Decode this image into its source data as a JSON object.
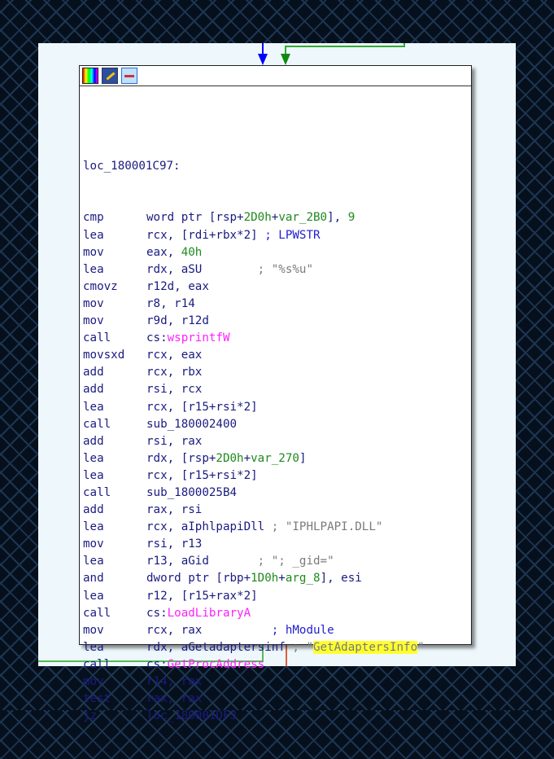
{
  "colors": {
    "edge_in": "#0000ff",
    "edge_true": "#22aa22",
    "edge_false": "#e05030",
    "highlight": "#ffff30"
  },
  "header_icons": [
    "color-palette-icon",
    "edit-node-icon",
    "group-nodes-icon"
  ],
  "label": "loc_180001C97:",
  "lines": [
    {
      "mn": "cmp",
      "ops": [
        [
          "word ptr [rsp+",
          "n"
        ],
        [
          "2D0h",
          "g"
        ],
        [
          "+",
          "n"
        ],
        [
          "var_2B0",
          "g"
        ],
        [
          "], ",
          "n"
        ],
        [
          "9",
          "g"
        ]
      ]
    },
    {
      "mn": "lea",
      "ops": [
        [
          "rcx, [rdi+rbx*2] ",
          "n"
        ],
        [
          "; LPWSTR",
          "b"
        ]
      ]
    },
    {
      "mn": "mov",
      "ops": [
        [
          "eax, ",
          "n"
        ],
        [
          "40h",
          "g"
        ]
      ]
    },
    {
      "mn": "lea",
      "ops": [
        [
          "rdx, aSU        ",
          "n"
        ],
        [
          "; \"%s%u\"",
          "s"
        ]
      ]
    },
    {
      "mn": "cmovz",
      "ops": [
        [
          "r12d, eax",
          "n"
        ]
      ]
    },
    {
      "mn": "mov",
      "ops": [
        [
          "r8, r14",
          "n"
        ]
      ]
    },
    {
      "mn": "mov",
      "ops": [
        [
          "r9d, r12d",
          "n"
        ]
      ]
    },
    {
      "mn": "call",
      "ops": [
        [
          "cs:",
          "n"
        ],
        [
          "wsprintfW",
          "m"
        ]
      ]
    },
    {
      "mn": "movsxd",
      "ops": [
        [
          "rcx, eax",
          "n"
        ]
      ]
    },
    {
      "mn": "add",
      "ops": [
        [
          "rcx, rbx",
          "n"
        ]
      ]
    },
    {
      "mn": "add",
      "ops": [
        [
          "rsi, rcx",
          "n"
        ]
      ]
    },
    {
      "mn": "lea",
      "ops": [
        [
          "rcx, [r15+rsi*2]",
          "n"
        ]
      ]
    },
    {
      "mn": "call",
      "ops": [
        [
          "sub_180002400",
          "n"
        ]
      ]
    },
    {
      "mn": "add",
      "ops": [
        [
          "rsi, rax",
          "n"
        ]
      ]
    },
    {
      "mn": "lea",
      "ops": [
        [
          "rdx, [rsp+",
          "n"
        ],
        [
          "2D0h",
          "g"
        ],
        [
          "+",
          "n"
        ],
        [
          "var_270",
          "g"
        ],
        [
          "]",
          "n"
        ]
      ]
    },
    {
      "mn": "lea",
      "ops": [
        [
          "rcx, [r15+rsi*2]",
          "n"
        ]
      ]
    },
    {
      "mn": "call",
      "ops": [
        [
          "sub_1800025B4",
          "n"
        ]
      ]
    },
    {
      "mn": "add",
      "ops": [
        [
          "rax, rsi",
          "n"
        ]
      ]
    },
    {
      "mn": "lea",
      "ops": [
        [
          "rcx, aIphlpapiDll ",
          "n"
        ],
        [
          "; \"IPHLPAPI.DLL\"",
          "s"
        ]
      ]
    },
    {
      "mn": "mov",
      "ops": [
        [
          "rsi, r13",
          "n"
        ]
      ]
    },
    {
      "mn": "lea",
      "ops": [
        [
          "r13, aGid       ",
          "n"
        ],
        [
          "; \"; _gid=\"",
          "s"
        ]
      ]
    },
    {
      "mn": "and",
      "ops": [
        [
          "dword ptr [rbp+",
          "n"
        ],
        [
          "1D0h",
          "g"
        ],
        [
          "+",
          "n"
        ],
        [
          "arg_8",
          "g"
        ],
        [
          "], esi",
          "n"
        ]
      ]
    },
    {
      "mn": "lea",
      "ops": [
        [
          "r12, [r15+rax*2]",
          "n"
        ]
      ]
    },
    {
      "mn": "call",
      "ops": [
        [
          "cs:",
          "n"
        ],
        [
          "LoadLibraryA",
          "m"
        ]
      ]
    },
    {
      "mn": "mov",
      "ops": [
        [
          "rcx, rax          ",
          "n"
        ],
        [
          "; hModule",
          "b"
        ]
      ]
    },
    {
      "mn": "lea",
      "ops": [
        [
          "rdx, aGetadaptersinf ",
          "n"
        ],
        [
          "; \"",
          "s"
        ],
        [
          "GetAdaptersInfo",
          "hl"
        ],
        [
          "\"",
          "s"
        ]
      ]
    },
    {
      "mn": "call",
      "ops": [
        [
          "cs:",
          "n"
        ],
        [
          "GetProcAddress",
          "m"
        ]
      ]
    },
    {
      "mn": "mov",
      "ops": [
        [
          "r14, rax",
          "n"
        ]
      ]
    },
    {
      "mn": "test",
      "ops": [
        [
          "rax, rax",
          "n"
        ]
      ]
    },
    {
      "mn": "jz",
      "ops": [
        [
          "loc_180001DF3",
          "n"
        ]
      ]
    }
  ]
}
